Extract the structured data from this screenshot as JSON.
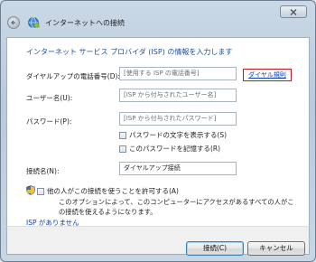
{
  "window": {
    "title": "インターネットへの接続"
  },
  "heading": "インターネット サービス プロバイダ (ISP) の情報を入力します",
  "form": {
    "phone": {
      "label": "ダイヤルアップの電話番号(D):",
      "placeholder": "[使用する ISP の電話番号]"
    },
    "dialing_rules_link": "ダイヤル規則",
    "username": {
      "label": "ユーザー名(U):",
      "placeholder": "[ISP から付与されたユーザー名]"
    },
    "password": {
      "label": "パスワード(P):",
      "placeholder": "[ISP から付与されたパスワード]"
    },
    "show_password": {
      "label": "パスワードの文字を表示する(S)",
      "checked": false
    },
    "remember_password": {
      "label": "このパスワードを記憶する(R)",
      "checked": false
    },
    "connection_name": {
      "label": "接続名(N):",
      "value": "ダイヤルアップ接続"
    },
    "allow_others": {
      "label": "他の人がこの接続を使うことを許可する(A)",
      "checked": false,
      "description": "このオプションによって、このコンピューターにアクセスがあるすべての人がこの接続を使えるようになります。"
    }
  },
  "no_isp_link": "ISP がありません",
  "buttons": {
    "connect": "接続(C)",
    "cancel": "キャンセル"
  },
  "icons": {
    "back": "back-arrow-icon",
    "close": "close-icon",
    "wizard": "network-globe-icon",
    "shield": "uac-shield-icon"
  }
}
